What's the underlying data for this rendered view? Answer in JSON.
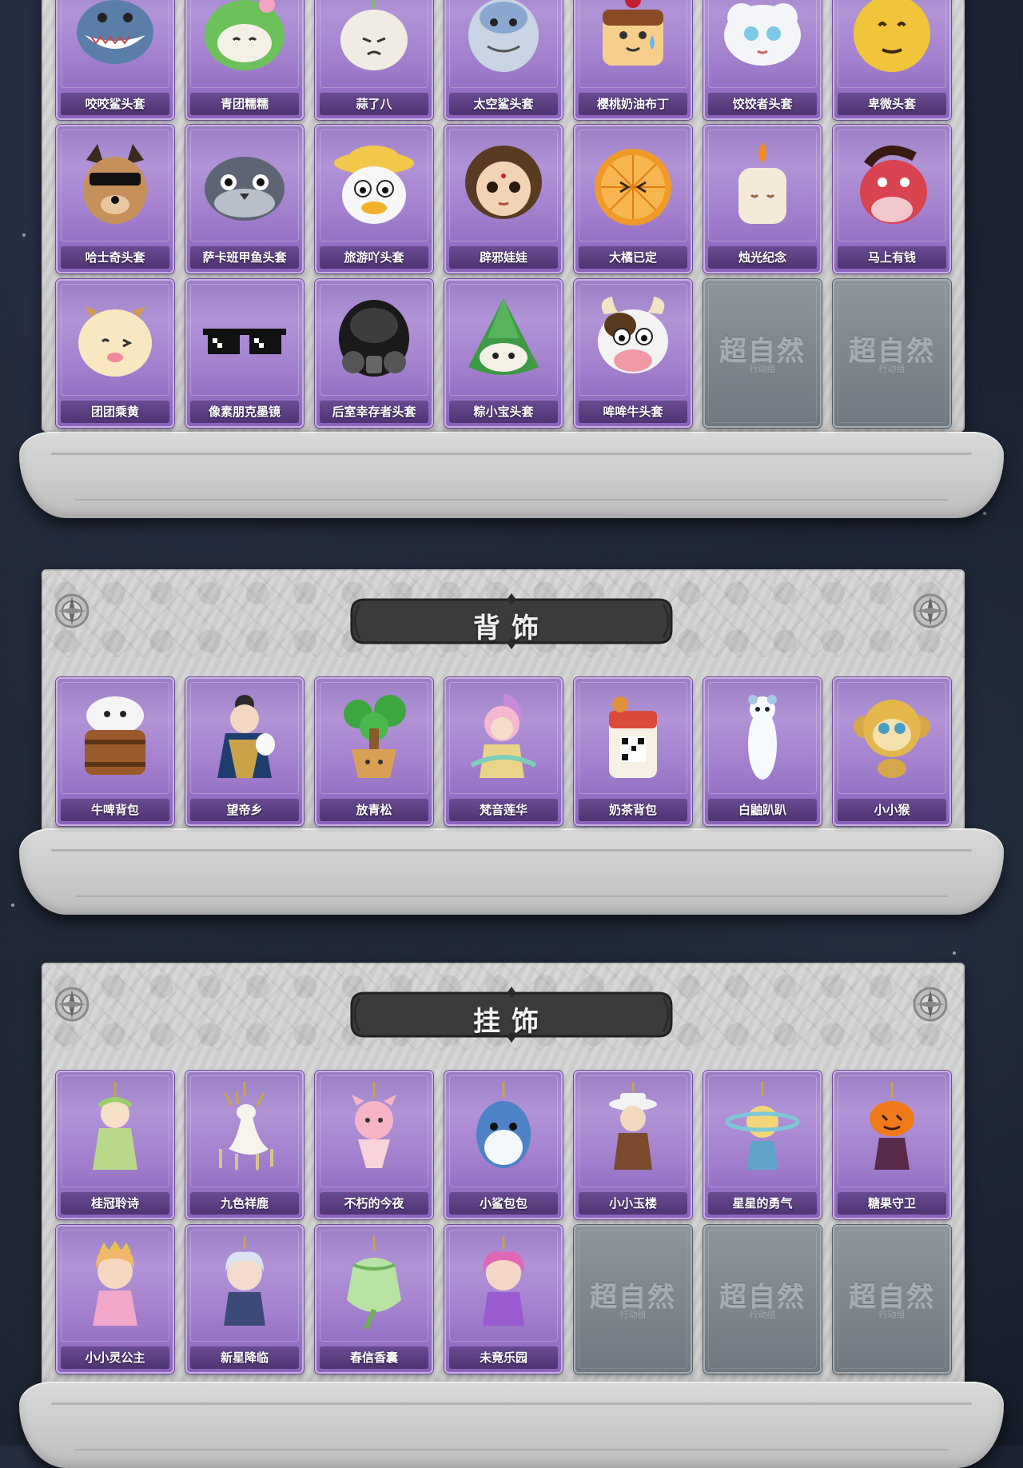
{
  "sections": [
    {
      "id": "headwear",
      "title": "",
      "cards": [
        {
          "label": "咬咬鲨头套",
          "icon": "shark-head-icon",
          "empty": false
        },
        {
          "label": "青团糯糯",
          "icon": "green-mochi-icon",
          "empty": false
        },
        {
          "label": "蒜了八",
          "icon": "garlic-icon",
          "empty": false
        },
        {
          "label": "太空鲨头套",
          "icon": "space-shark-icon",
          "empty": false
        },
        {
          "label": "樱桃奶油布丁",
          "icon": "pudding-icon",
          "empty": false
        },
        {
          "label": "饺饺者头套",
          "icon": "dumpling-cloud-icon",
          "empty": false
        },
        {
          "label": "卑微头套",
          "icon": "smiley-face-icon",
          "empty": false
        },
        {
          "label": "哈士奇头套",
          "icon": "husky-icon",
          "empty": false
        },
        {
          "label": "萨卡班甲鱼头套",
          "icon": "fish-head-icon",
          "empty": false
        },
        {
          "label": "旅游吖头套",
          "icon": "duck-hat-icon",
          "empty": false
        },
        {
          "label": "辟邪娃娃",
          "icon": "doll-icon",
          "empty": false
        },
        {
          "label": "大橘已定",
          "icon": "orange-icon",
          "empty": false
        },
        {
          "label": "烛光纪念",
          "icon": "candle-icon",
          "empty": false
        },
        {
          "label": "马上有钱",
          "icon": "horse-head-icon",
          "empty": false
        },
        {
          "label": "团团乘黄",
          "icon": "cream-beast-icon",
          "empty": false
        },
        {
          "label": "像素朋克墨镜",
          "icon": "pixel-sunglasses-icon",
          "empty": false
        },
        {
          "label": "后室幸存者头套",
          "icon": "gas-mask-icon",
          "empty": false
        },
        {
          "label": "粽小宝头套",
          "icon": "zongzi-icon",
          "empty": false
        },
        {
          "label": "哞哞牛头套",
          "icon": "cow-head-icon",
          "empty": false
        },
        {
          "label": "",
          "icon": "locked-placeholder-icon",
          "empty": true
        },
        {
          "label": "",
          "icon": "locked-placeholder-icon",
          "empty": true
        }
      ]
    },
    {
      "id": "back",
      "title": "背饰",
      "cards": [
        {
          "label": "牛啤背包",
          "icon": "beer-keg-cow-icon",
          "empty": false
        },
        {
          "label": "望帝乡",
          "icon": "figure-with-mask-icon",
          "empty": false
        },
        {
          "label": "放青松",
          "icon": "pine-tree-pot-icon",
          "empty": false
        },
        {
          "label": "梵音莲华",
          "icon": "lotus-figure-icon",
          "empty": false
        },
        {
          "label": "奶茶背包",
          "icon": "milk-tea-icon",
          "empty": false
        },
        {
          "label": "白鼬趴趴",
          "icon": "white-weasel-icon",
          "empty": false
        },
        {
          "label": "小小猴",
          "icon": "monkey-icon",
          "empty": false
        }
      ]
    },
    {
      "id": "pendant",
      "title": "挂饰",
      "cards": [
        {
          "label": "桂冠聆诗",
          "icon": "laurel-fairy-icon",
          "empty": false
        },
        {
          "label": "九色祥鹿",
          "icon": "deer-icon",
          "empty": false
        },
        {
          "label": "不朽的今夜",
          "icon": "fox-bouquet-icon",
          "empty": false
        },
        {
          "label": "小鲨包包",
          "icon": "shark-bag-icon",
          "empty": false
        },
        {
          "label": "小小玉楼",
          "icon": "hat-boy-icon",
          "empty": false
        },
        {
          "label": "星星的勇气",
          "icon": "star-planet-icon",
          "empty": false
        },
        {
          "label": "糖果守卫",
          "icon": "pumpkin-icon",
          "empty": false
        },
        {
          "label": "小小灵公主",
          "icon": "princess-icon",
          "empty": false
        },
        {
          "label": "新星降临",
          "icon": "silver-hair-icon",
          "empty": false
        },
        {
          "label": "春信香囊",
          "icon": "sachet-icon",
          "empty": false
        },
        {
          "label": "未竟乐园",
          "icon": "pink-girl-icon",
          "empty": false
        },
        {
          "label": "",
          "icon": "locked-placeholder-icon",
          "empty": true
        },
        {
          "label": "",
          "icon": "locked-placeholder-icon",
          "empty": true
        },
        {
          "label": "",
          "icon": "locked-placeholder-icon",
          "empty": true
        }
      ]
    }
  ],
  "placeholder": {
    "mark": "超自然",
    "sub": "行动组"
  },
  "colors": {
    "card_purple": "#a27fcd",
    "card_label_bg": "#4f3372",
    "panel_bg": "#d2d2d2",
    "banner": "#3b3b3b",
    "empty_card": "#7d868d"
  }
}
